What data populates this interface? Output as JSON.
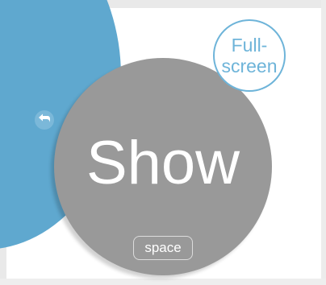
{
  "presentation": {
    "show_label": "Show",
    "show_shortcut": "space",
    "fullscreen_line1": "Full-",
    "fullscreen_line2": "screen"
  },
  "icons": {
    "back": "back-arrow-icon"
  },
  "colors": {
    "panel_blue": "#5fa8cf",
    "show_gray": "#999999",
    "fullscreen_accent": "#6eb4d9",
    "text_white": "#ffffff"
  }
}
